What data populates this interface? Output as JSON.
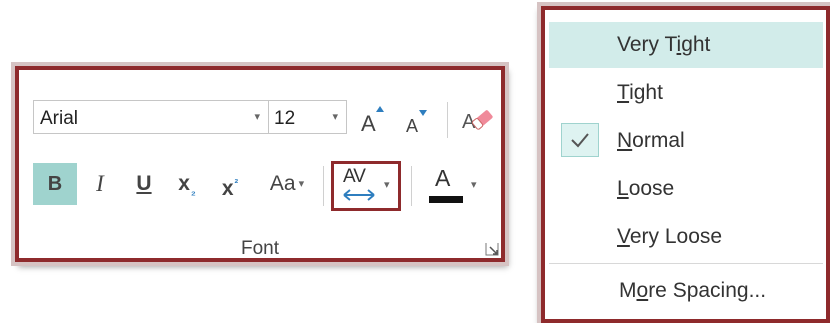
{
  "font_group": {
    "font_name": "Arial",
    "font_size": "12",
    "bold_label": "B",
    "italic_label": "I",
    "underline_label": "U",
    "subscript_label": "x",
    "subscript_mark": "₂",
    "superscript_label": "x",
    "superscript_mark": "²",
    "change_case_label": "Aa",
    "character_spacing_label": "AV",
    "font_color_label": "A",
    "font_color_bar": "#111111",
    "bold_active_color": "#9fd3ce",
    "group_label": "Font",
    "dropdown_glyph": "▾"
  },
  "spacing_menu": {
    "items": [
      {
        "label": "Very Tight",
        "hotkey_index": 6,
        "highlighted": true,
        "checked": false
      },
      {
        "label": "Tight",
        "hotkey_index": 0,
        "highlighted": false,
        "checked": false
      },
      {
        "label": "Normal",
        "hotkey_index": 0,
        "highlighted": false,
        "checked": true
      },
      {
        "label": "Loose",
        "hotkey_index": 0,
        "highlighted": false,
        "checked": false
      },
      {
        "label": "Very Loose",
        "hotkey_index": 0,
        "highlighted": false,
        "checked": false
      }
    ],
    "more": {
      "label": "More Spacing...",
      "hotkey_index": 1
    },
    "highlight_color": "#d2ecea"
  },
  "icons": {
    "grow": "grow-font-icon",
    "shrink": "shrink-font-icon",
    "clear": "clear-formatting-icon",
    "check": "checkmark-icon",
    "launcher": "dialog-launcher-icon"
  },
  "accent_border": "#8e2a2c"
}
